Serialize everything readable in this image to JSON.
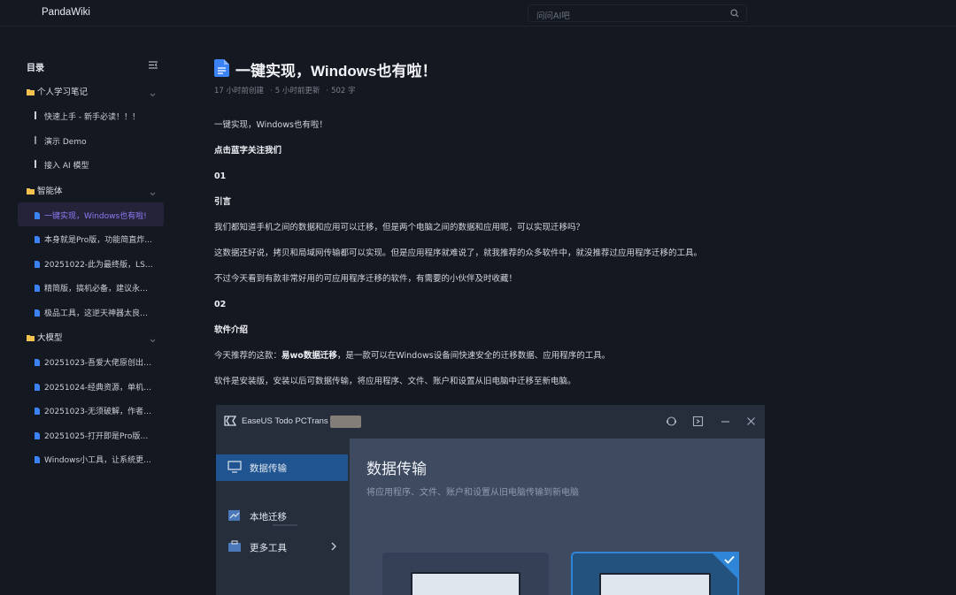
{
  "app": {
    "name": "PandaWiki"
  },
  "search": {
    "placeholder": "问问AI吧"
  },
  "sidebar": {
    "title": "目录",
    "groups": [
      {
        "label": "个人学习笔记",
        "items": [
          "快速上手 - 新手必读！！！",
          "演示 Demo",
          "接入 AI 模型"
        ]
      },
      {
        "label": "智能体",
        "items": [
          "一键实现，Windows也有啦!",
          "本身就是Pro版，功能简直炸...",
          "20251022-此为最终版，LSJ...",
          "精简版，搞机必备，建议永久...",
          "极品工具，这逆天神器太良心..."
        ]
      },
      {
        "label": "大模型",
        "items": [
          "20251023-吾爱大佬原创出品...",
          "20251024-经典资源，单机离...",
          "20251023-无须破解，作者承...",
          "20251025-打开即是Pro版，...",
          "Windows小工具，让系统更..."
        ]
      }
    ],
    "active_item": "一键实现，Windows也有啦!"
  },
  "article": {
    "title": "一键实现，Windows也有啦！",
    "meta": {
      "created": "17 小时前创建",
      "updated": "5 小时前更新",
      "words": "502 字"
    },
    "paragraphs": {
      "p1": "一键实现，Windows也有啦！",
      "p2": "点击蓝字关注我们",
      "p3": "01",
      "p4": "引言",
      "p5": "我们都知道手机之间的数据和应用可以迁移，但是两个电脑之间的数据和应用呢，可以实现迁移吗？",
      "p6": "这数据还好说，拷贝和局域网传输都可以实现。但是应用程序就难说了，就我推荐的众多软件中，就没推荐过应用程序迁移的工具。",
      "p7": "不过今天看到有款非常好用的可应用程序迁移的软件，有需要的小伙伴及时收藏！",
      "p8": "02",
      "p9": "软件介绍",
      "p10_pre": "今天推荐的这款：",
      "p10_bold": "易wo数据迁移",
      "p10_post": "，是一款可以在Windows设备间快速安全的迁移数据、应用程序的工具。",
      "p11": "软件是安装版，安装以后可数据传输，将应用程序、文件、账户和设置从旧电脑中迁移至新电脑。"
    }
  },
  "screenshot": {
    "app_name": "EaseUS Todo PCTrans",
    "nav": [
      "数据传输",
      "本地迁移",
      "更多工具"
    ],
    "heading": "数据传输",
    "subheading": "将应用程序、文件、账户和设置从旧电脑传输到新电脑"
  },
  "colors": {
    "accent": "#8b7cf6",
    "folder": "#f2c14e",
    "doc": "#3b82f6",
    "bg": "#141821"
  }
}
